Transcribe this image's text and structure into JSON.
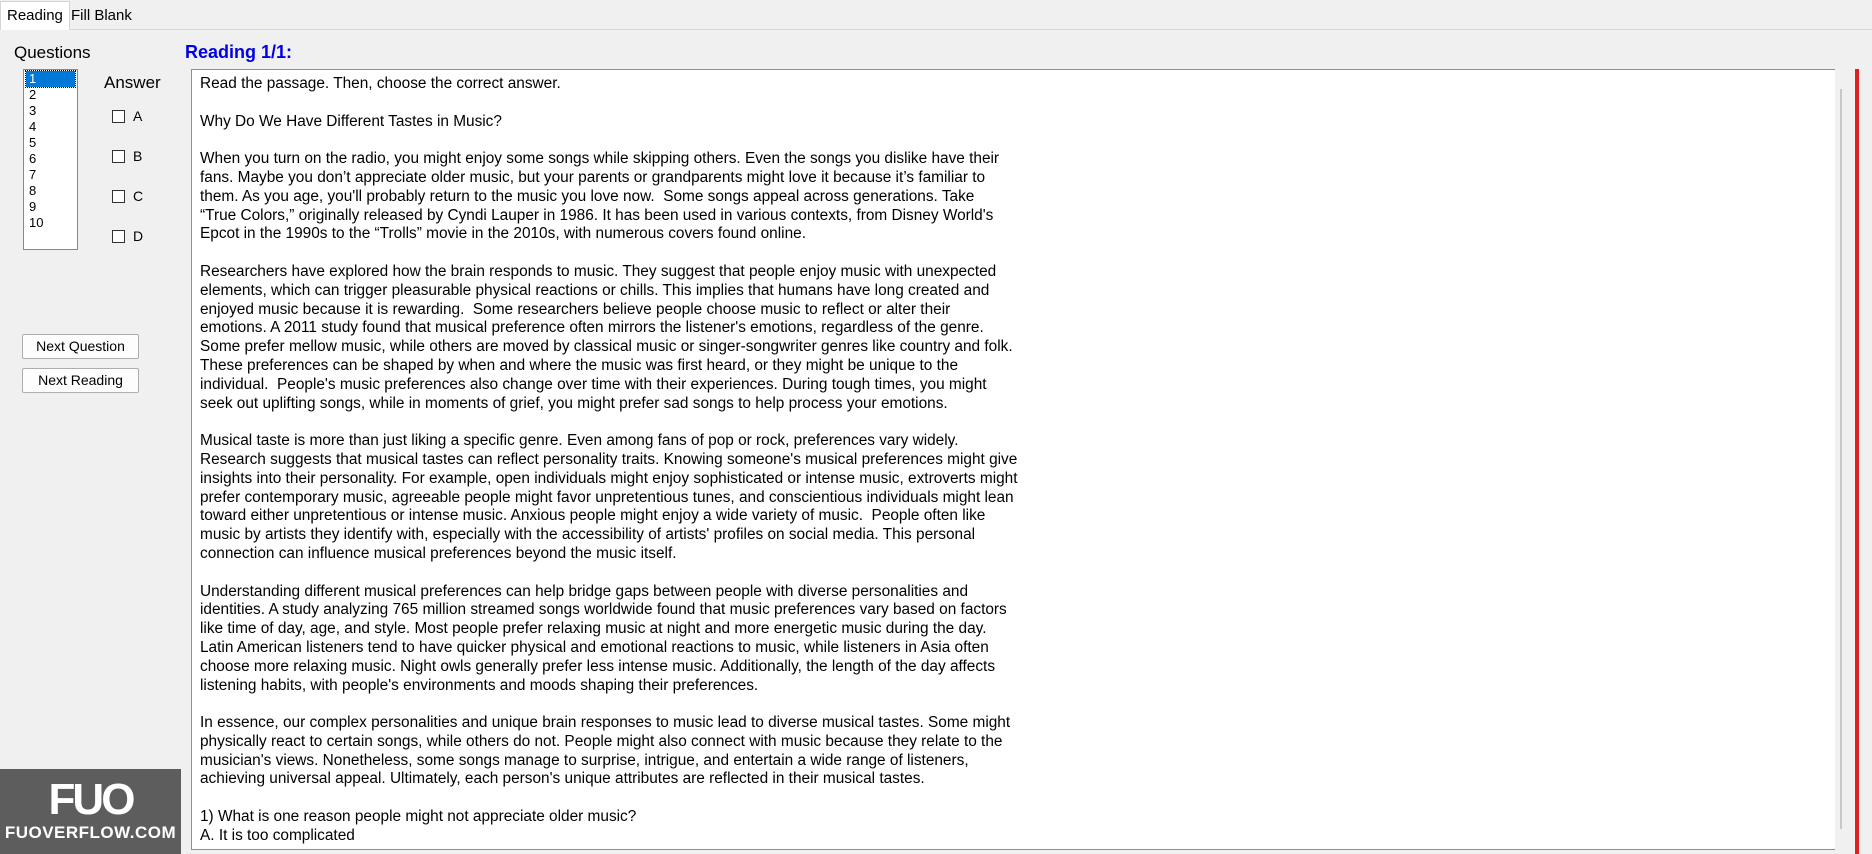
{
  "tabs": [
    {
      "label": "Reading"
    },
    {
      "label": "Fill Blank"
    }
  ],
  "left_panel": {
    "questions_label": "Questions",
    "question_numbers": [
      "1",
      "2",
      "3",
      "4",
      "5",
      "6",
      "7",
      "8",
      "9",
      "10"
    ],
    "selected_question": "1",
    "answer_label": "Answer",
    "options": [
      "A",
      "B",
      "C",
      "D"
    ],
    "next_question_label": "Next Question",
    "next_reading_label": "Next Reading"
  },
  "reading": {
    "title": "Reading 1/1:",
    "passage": "Read the passage. Then, choose the correct answer.\n\nWhy Do We Have Different Tastes in Music?\n\nWhen you turn on the radio, you might enjoy some songs while skipping others. Even the songs you dislike have their\nfans. Maybe you don’t appreciate older music, but your parents or grandparents might love it because it’s familiar to\nthem. As you age, you'll probably return to the music you love now.  Some songs appeal across generations. Take\n“True Colors,” originally released by Cyndi Lauper in 1986. It has been used in various contexts, from Disney World's\nEpcot in the 1990s to the “Trolls” movie in the 2010s, with numerous covers found online.\n\nResearchers have explored how the brain responds to music. They suggest that people enjoy music with unexpected\nelements, which can trigger pleasurable physical reactions or chills. This implies that humans have long created and\nenjoyed music because it is rewarding.  Some researchers believe people choose music to reflect or alter their\nemotions. A 2011 study found that musical preference often mirrors the listener's emotions, regardless of the genre.\nSome prefer mellow music, while others are moved by classical music or singer-songwriter genres like country and folk.\nThese preferences can be shaped by when and where the music was first heard, or they might be unique to the\nindividual.  People's music preferences also change over time with their experiences. During tough times, you might\nseek out uplifting songs, while in moments of grief, you might prefer sad songs to help process your emotions.\n\nMusical taste is more than just liking a specific genre. Even among fans of pop or rock, preferences vary widely.\nResearch suggests that musical tastes can reflect personality traits. Knowing someone's musical preferences might give\ninsights into their personality. For example, open individuals might enjoy sophisticated or intense music, extroverts might\nprefer contemporary music, agreeable people might favor unpretentious tunes, and conscientious individuals might lean\ntoward either unpretentious or intense music. Anxious people might enjoy a wide variety of music.  People often like\nmusic by artists they identify with, especially with the accessibility of artists' profiles on social media. This personal\nconnection can influence musical preferences beyond the music itself.\n\nUnderstanding different musical preferences can help bridge gaps between people with diverse personalities and\nidentities. A study analyzing 765 million streamed songs worldwide found that music preferences vary based on factors\nlike time of day, age, and style. Most people prefer relaxing music at night and more energetic music during the day.\nLatin American listeners tend to have quicker physical and emotional reactions to music, while listeners in Asia often\nchoose more relaxing music. Night owls generally prefer less intense music. Additionally, the length of the day affects\nlistening habits, with people's environments and moods shaping their preferences.\n\nIn essence, our complex personalities and unique brain responses to music lead to diverse musical tastes. Some might\nphysically react to certain songs, while others do not. People might also connect with music because they relate to the\nmusician's views. Nonetheless, some songs manage to surprise, intrigue, and entertain a wide range of listeners,\nachieving universal appeal. Ultimately, each person's unique attributes are reflected in their musical tastes.\n\n1) What is one reason people might not appreciate older music?\nA. It is too complicated"
  },
  "watermark": {
    "logo": "FUO",
    "site": "FUOVERFLOW.COM"
  },
  "colors": {
    "title_blue": "#0000e6",
    "selection_blue": "#0078d7",
    "accent_red": "#e02020"
  }
}
